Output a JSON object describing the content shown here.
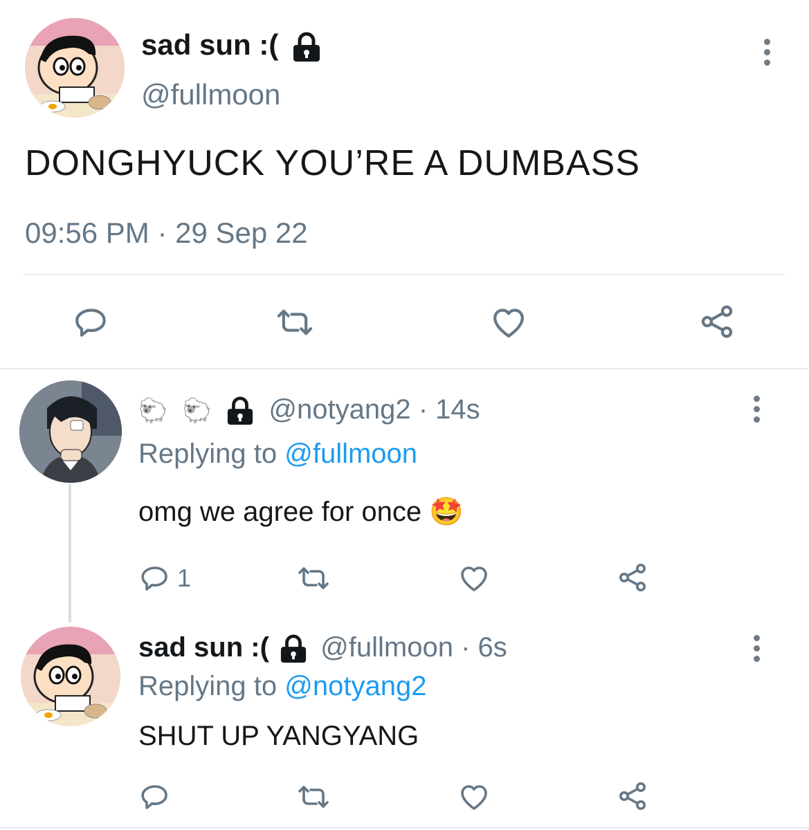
{
  "main_tweet": {
    "display_name": "sad sun :(",
    "handle": "@fullmoon",
    "text": "DONGHYUCK YOU’RE A DUMBASS",
    "time": "09:56 PM",
    "date": "29 Sep 22"
  },
  "replies": [
    {
      "display_name": "🐑 🐑",
      "handle": "@notyang2",
      "age": "14s",
      "replying_label": "Replying to",
      "replying_to": "@fullmoon",
      "text": "omg we agree for once",
      "emoji": "🤩",
      "reply_count": "1"
    },
    {
      "display_name": "sad sun :(",
      "handle": "@fullmoon",
      "age": "6s",
      "replying_label": "Replying to",
      "replying_to": "@notyang2",
      "text": "SHUT UP YANGYANG"
    }
  ],
  "colors": {
    "link": "#1d9bf0",
    "muted": "#657786",
    "text": "#14171a",
    "divider": "#e6ecf0"
  },
  "icons": [
    "lock-icon",
    "more-icon",
    "reply-icon",
    "retweet-icon",
    "like-icon",
    "share-icon"
  ]
}
